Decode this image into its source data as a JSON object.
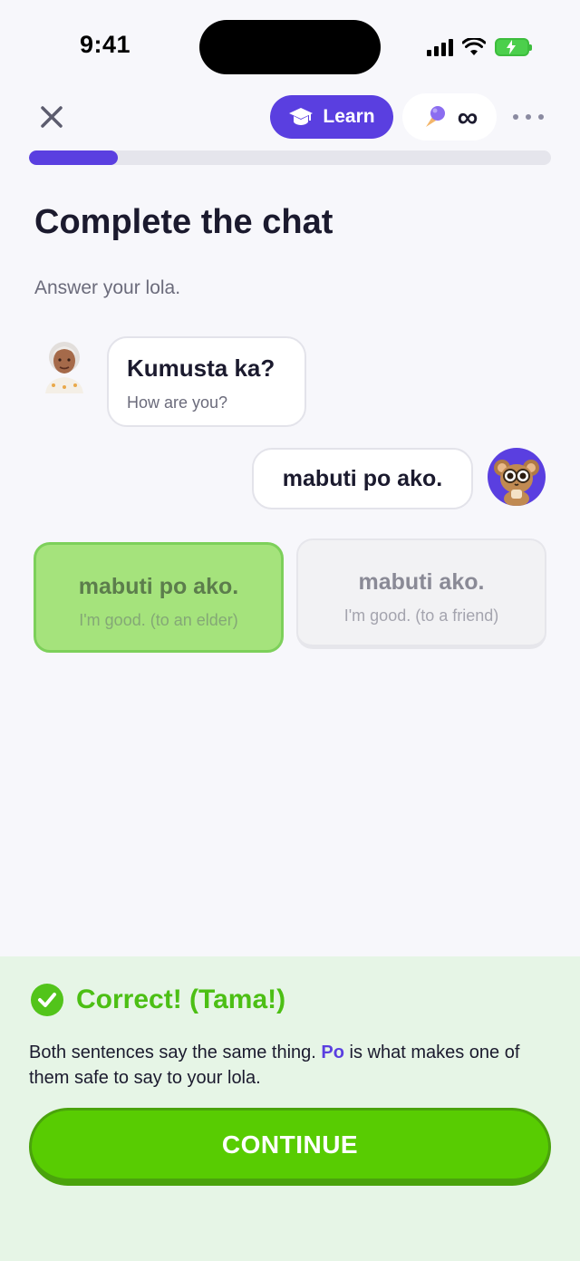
{
  "status_bar": {
    "time": "9:41"
  },
  "header": {
    "learn_label": "Learn",
    "hearts_value": "∞",
    "progress": 0.17,
    "accent_color": "#5a3fe0"
  },
  "exercise": {
    "title": "Complete the chat",
    "instruction": "Answer your lola."
  },
  "chat": {
    "prompt": {
      "text": "Kumusta ka?",
      "translation": "How are you?"
    },
    "reply": {
      "text": "mabuti po ako."
    }
  },
  "options": [
    {
      "text": "mabuti po ako.",
      "translation": "I'm good. (to an elder)",
      "state": "selected-correct"
    },
    {
      "text": "mabuti ako.",
      "translation": "I'm good. (to a friend)",
      "state": "disabled"
    }
  ],
  "feedback": {
    "title": "Correct! (Tama!)",
    "text_before": "Both sentences say the same thing. ",
    "highlight": "Po",
    "text_after": " is what makes one of them safe to say to your lola.",
    "continue_label": "CONTINUE",
    "success_color": "#58cc02"
  }
}
